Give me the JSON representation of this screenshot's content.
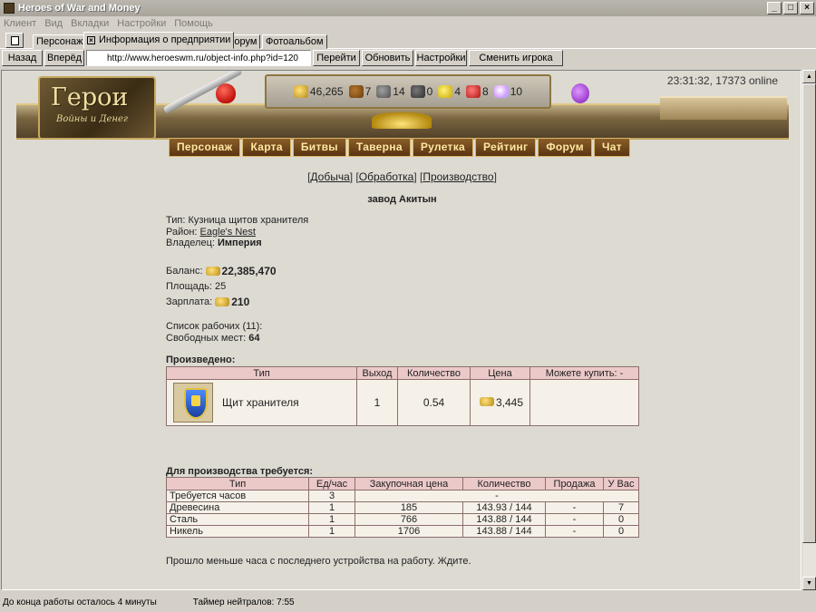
{
  "window": {
    "title": "Heroes of War and Money"
  },
  "menu": [
    "Клиент",
    "Вид",
    "Вкладки",
    "Настройки",
    "Помощь"
  ],
  "tabs": [
    {
      "label": "Персонаж",
      "active": false
    },
    {
      "label": "Информация о предприятии",
      "active": true
    },
    {
      "label": "Форум",
      "active": false
    },
    {
      "label": "Фотоальбом",
      "active": false
    }
  ],
  "nav": {
    "back": "Назад",
    "forward": "Вперёд",
    "url": "http://www.heroeswm.ru/object-info.php?id=120",
    "go": "Перейти",
    "refresh": "Обновить",
    "settings": "Настройки",
    "switch_player": "Сменить игрока"
  },
  "header": {
    "online": "23:31:32, 17373 online",
    "logo_title": "Герои",
    "logo_subtitle": "Войны и Денег",
    "resources": [
      {
        "icon": "gold-icon",
        "value": "46,265"
      },
      {
        "icon": "wood-icon",
        "value": "7"
      },
      {
        "icon": "ore-icon",
        "value": "14"
      },
      {
        "icon": "mercury-icon",
        "value": "0"
      },
      {
        "icon": "sulfur-icon",
        "value": "4"
      },
      {
        "icon": "crystal-icon",
        "value": "8"
      },
      {
        "icon": "gems-icon",
        "value": "10"
      }
    ],
    "nav_items": [
      "Персонаж",
      "Карта",
      "Битвы",
      "Таверна",
      "Рулетка",
      "Рейтинг",
      "Форум",
      "Чат"
    ]
  },
  "page": {
    "links": [
      "Добыча",
      "Обработка",
      "Производство"
    ],
    "title": "завод Акитын",
    "type_label": "Тип:",
    "type_value": "Кузница щитов хранителя",
    "district_label": "Район:",
    "district_value": "Eagle's Nest",
    "owner_label": "Владелец:",
    "owner_value": "Империя",
    "balance_label": "Баланс:",
    "balance_value": "22,385,470",
    "area_label": "Площадь:",
    "area_value": "25",
    "salary_label": "Зарплата:",
    "salary_value": "210",
    "workers_label": "Список рабочих (11):",
    "free_label": "Свободных мест:",
    "free_value": "64",
    "produced_title": "Произведено:",
    "produced_headers": [
      "Тип",
      "Выход",
      "Количество",
      "Цена",
      "Можете купить: -"
    ],
    "produced_row": {
      "name": "Щит хранителя",
      "output": "1",
      "quantity": "0.54",
      "price": "3,445"
    },
    "required_title": "Для производства требуется:",
    "required_headers": [
      "Тип",
      "Ед/час",
      "Закупочная цена",
      "Количество",
      "Продажа",
      "У Вас"
    ],
    "hours_row": {
      "name": "Требуется часов",
      "value": "3",
      "dash": "-"
    },
    "required_rows": [
      {
        "name": "Древесина",
        "per_hour": "1",
        "price": "185",
        "qty": "143.93 / 144",
        "sale": "-",
        "have": "7"
      },
      {
        "name": "Сталь",
        "per_hour": "1",
        "price": "766",
        "qty": "143.88 / 144",
        "sale": "-",
        "have": "0"
      },
      {
        "name": "Никель",
        "per_hour": "1",
        "price": "1706",
        "qty": "143.88 / 144",
        "sale": "-",
        "have": "0"
      }
    ],
    "wait_message": "Прошло меньше часа с последнего устройства на работу. Ждите."
  },
  "status": {
    "left": "До конца работы осталось 4 минуты",
    "right": "Таймер нейтралов: 7:55"
  }
}
